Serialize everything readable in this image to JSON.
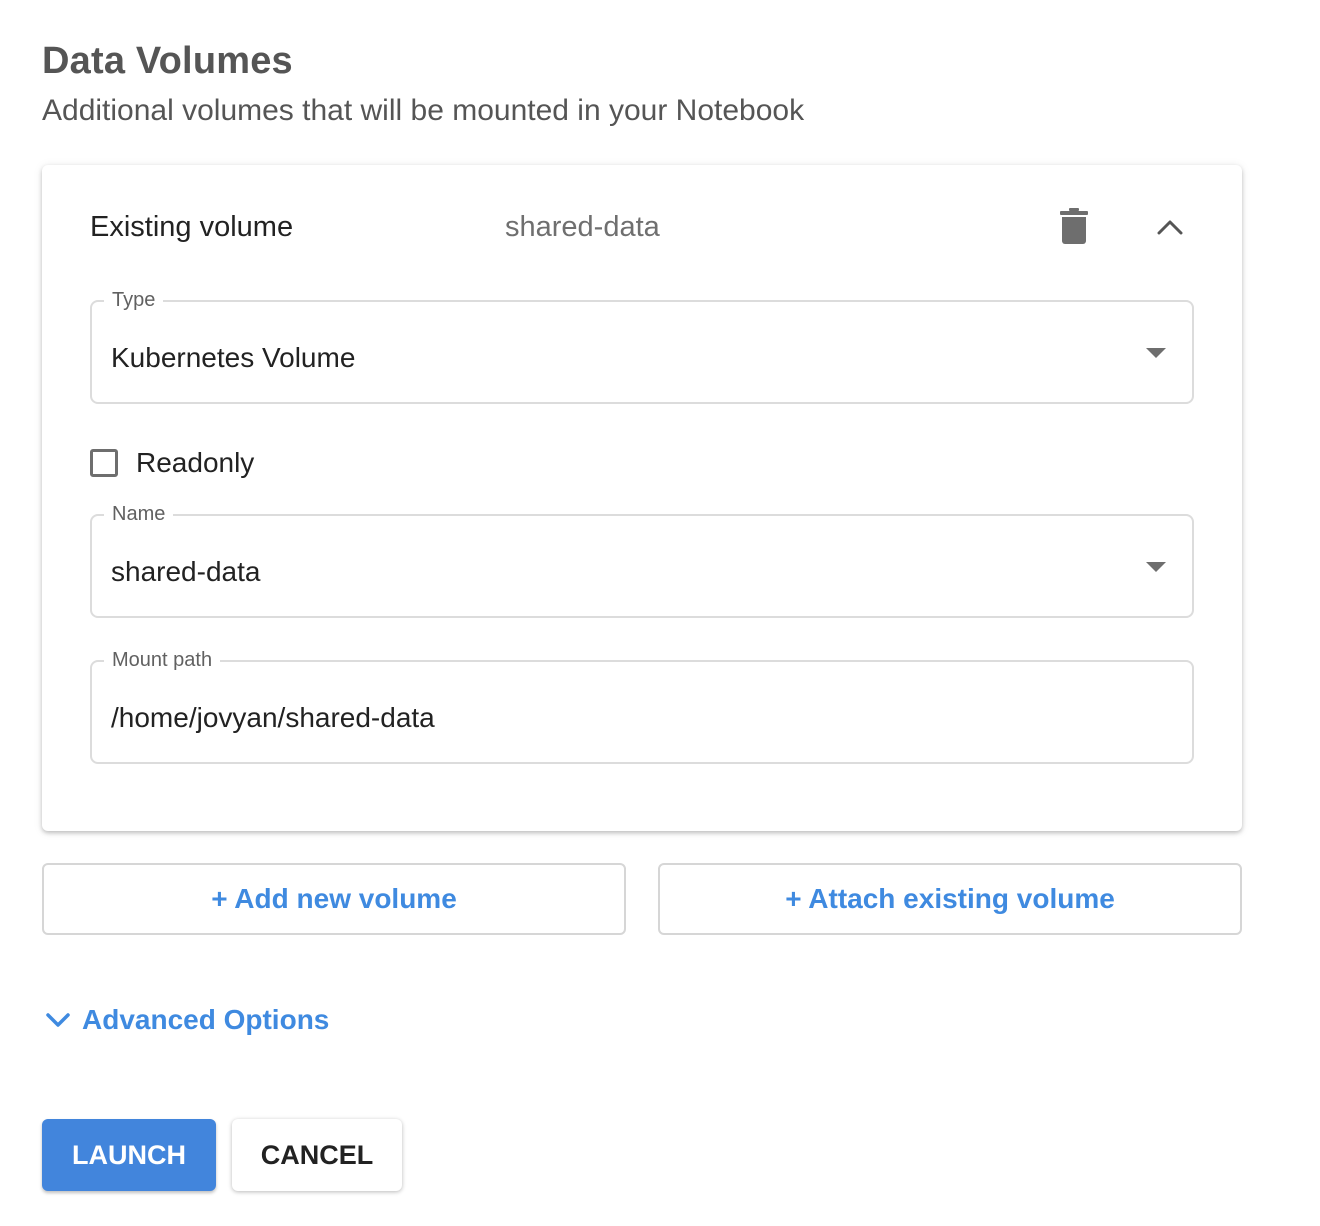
{
  "section": {
    "title": "Data Volumes",
    "subtitle": "Additional volumes that will be mounted in your Notebook"
  },
  "volume_card": {
    "header_label": "Existing volume",
    "header_value": "shared-data",
    "expanded": true,
    "type_field": {
      "label": "Type",
      "value": "Kubernetes Volume"
    },
    "readonly": {
      "label": "Readonly",
      "checked": false
    },
    "name_field": {
      "label": "Name",
      "value": "shared-data"
    },
    "mount_path_field": {
      "label": "Mount path",
      "value": "/home/jovyan/shared-data"
    }
  },
  "actions": {
    "add_new_volume": "+ Add new volume",
    "attach_existing_volume": "+ Attach existing volume"
  },
  "advanced_options": {
    "label": "Advanced Options"
  },
  "footer": {
    "launch_label": "LAUNCH",
    "cancel_label": "CANCEL"
  },
  "colors": {
    "accent": "#4285dc",
    "link": "#3f8ae0",
    "heading_text": "#555555",
    "border": "#dcdcdc"
  },
  "icons": {
    "delete": "trash-icon",
    "collapse": "chevron-up-icon",
    "dropdown": "caret-down-icon",
    "advanced": "chevron-down-icon"
  }
}
